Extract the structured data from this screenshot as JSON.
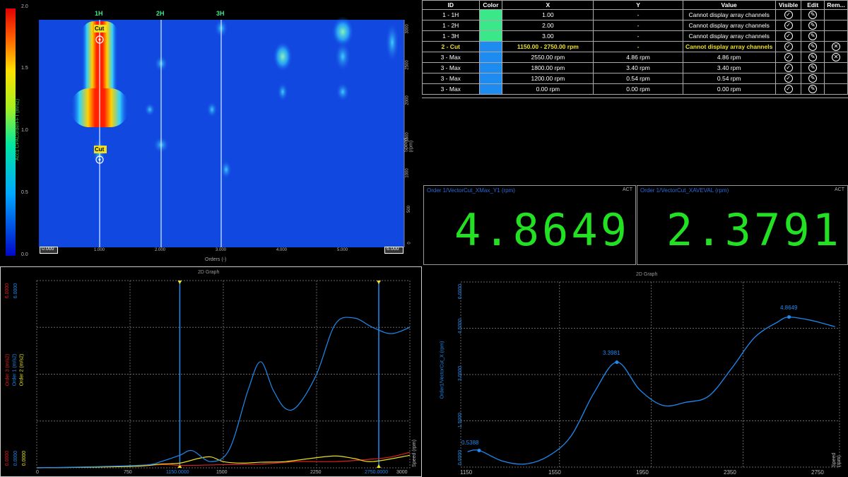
{
  "heatmap": {
    "colorbar_ticks": [
      "2.0",
      "1.5",
      "1.0",
      "0.5",
      "0.0"
    ],
    "colorbar_label": "Acc1 CPACorderFFT (m/s2)",
    "top_labels": [
      "1H",
      "2H",
      "3H"
    ],
    "cursor_labels": [
      "Cut",
      "Cut"
    ],
    "x_ticks": [
      "1.000",
      "2.000",
      "3.000",
      "4.000",
      "5.000"
    ],
    "x_min_label": "0.000",
    "x_max_label": "6.000",
    "x_label": "Orders (-)",
    "y_ticks": [
      "3000",
      "2500",
      "2000",
      "1500",
      "1000",
      "500",
      "0"
    ],
    "y_label": "Speed (rpm)"
  },
  "cursor_table": {
    "headers": [
      "ID",
      "Color",
      "X",
      "Y",
      "Value",
      "Visible",
      "Edit",
      "Rem..."
    ],
    "rows": [
      {
        "id": "1 - 1H",
        "color": "#3ae88a",
        "x": "1.00",
        "y": "-",
        "value": "Cannot display array channels",
        "rm": false,
        "hl": false
      },
      {
        "id": "1 - 2H",
        "color": "#3ae88a",
        "x": "2.00",
        "y": "-",
        "value": "Cannot display array channels",
        "rm": false,
        "hl": false
      },
      {
        "id": "1 - 3H",
        "color": "#3ae88a",
        "x": "3.00",
        "y": "-",
        "value": "Cannot display array channels",
        "rm": false,
        "hl": false
      },
      {
        "id": "2 - Cut",
        "color": "#1e8bf0",
        "x": "1150.00 - 2750.00 rpm",
        "y": "-",
        "value": "Cannot display array channels",
        "rm": true,
        "hl": true
      },
      {
        "id": "3 - Max",
        "color": "#1e8bf0",
        "x": "2550.00 rpm",
        "y": "4.86 rpm",
        "value": "4.86 rpm",
        "rm": true,
        "hl": false
      },
      {
        "id": "3 - Max",
        "color": "#1e8bf0",
        "x": "1800.00 rpm",
        "y": "3.40 rpm",
        "value": "3.40 rpm",
        "rm": false,
        "hl": false
      },
      {
        "id": "3 - Max",
        "color": "#1e8bf0",
        "x": "1200.00 rpm",
        "y": "0.54 rpm",
        "value": "0.54 rpm",
        "rm": false,
        "hl": false
      },
      {
        "id": "3 - Max",
        "color": "#1e8bf0",
        "x": "0.00 rpm",
        "y": "0.00 rpm",
        "value": "0.00 rpm",
        "rm": false,
        "hl": false
      }
    ]
  },
  "digital": [
    {
      "title": "Order 1/VectorCut_XMax_Y1 (rpm)",
      "act": "ACT",
      "value": "4.8649"
    },
    {
      "title": "Order 1/VectorCut_XAVEVAL (rpm)",
      "act": "ACT",
      "value": "2.3791"
    }
  ],
  "graph_left": {
    "title": "2D Graph",
    "y_axis_labels": [
      {
        "text": "Order 3 (m/s2)",
        "color": "#e02020"
      },
      {
        "text": "Order 1 (m/s2)",
        "color": "#1e8bf0"
      },
      {
        "text": "Order 2 (m/s2)",
        "color": "#e8e020"
      }
    ],
    "y_top_red": "6.0000",
    "y_top_blue": "6.0000",
    "y_bot_red": "0.0000",
    "y_bot_blue": "0.0000",
    "y_bot_yellow": "0.0000",
    "x_ticks": [
      "0",
      "750",
      "1150.0000",
      "1500",
      "2250",
      "2750.0000",
      "3000"
    ],
    "x_axis_label": "Speed (rpm)"
  },
  "graph_right": {
    "title": "2D Graph",
    "y_axis_label": "Order1/VectorCut_X (rpm)",
    "y_ticks": [
      "6.0000",
      "4.5000",
      "3.0000",
      "1.5000",
      "0.0000"
    ],
    "x_ticks": [
      "1150",
      "1550",
      "1950",
      "2350",
      "2750"
    ],
    "x_axis_label": "Speed (rpm)",
    "peak_labels": [
      "4.8649",
      "3.3981",
      "0.5388"
    ]
  },
  "chart_data": [
    {
      "type": "heatmap",
      "xlabel": "Orders (-)",
      "ylabel": "Speed (rpm)",
      "xlim": [
        0,
        6
      ],
      "ylim": [
        0,
        3000
      ],
      "colorbar_label": "Acc1 CPACorderFFT (m/s2)",
      "colorbar_range": [
        0,
        2
      ]
    },
    {
      "type": "line",
      "xlabel": "Speed (rpm)",
      "xlim": [
        0,
        3000
      ],
      "ylim": [
        0,
        6
      ],
      "series": [
        {
          "name": "Order 1 (m/s2)",
          "color": "#1e8bf0",
          "x": [
            0,
            300,
            600,
            900,
            1000,
            1150,
            1250,
            1400,
            1550,
            1700,
            1800,
            1900,
            2000,
            2100,
            2250,
            2400,
            2550,
            2700,
            2850,
            3000
          ],
          "values": [
            0,
            0.02,
            0.05,
            0.1,
            0.2,
            0.4,
            0.55,
            0.2,
            0.6,
            2.5,
            3.4,
            2.5,
            1.9,
            2.0,
            3.0,
            4.6,
            4.8,
            4.5,
            4.3,
            4.5
          ]
        },
        {
          "name": "Order 2 (m/s2)",
          "color": "#e8e020",
          "x": [
            0,
            400,
            800,
            1000,
            1150,
            1300,
            1400,
            1500,
            1650,
            1800,
            2000,
            2200,
            2400,
            2550,
            2700,
            3000
          ],
          "values": [
            0,
            0.02,
            0.05,
            0.12,
            0.15,
            0.3,
            0.35,
            0.2,
            0.15,
            0.18,
            0.2,
            0.3,
            0.38,
            0.3,
            0.2,
            0.4
          ]
        },
        {
          "name": "Order 3 (m/s2)",
          "color": "#e02020",
          "x": [
            0,
            400,
            800,
            1000,
            1200,
            1500,
            1800,
            2100,
            2400,
            2700,
            2850,
            3000
          ],
          "values": [
            0,
            0.02,
            0.05,
            0.1,
            0.08,
            0.1,
            0.12,
            0.2,
            0.2,
            0.28,
            0.35,
            0.5
          ]
        }
      ]
    },
    {
      "type": "line",
      "xlabel": "Speed (rpm)",
      "ylabel": "Order1/VectorCut_X (rpm)",
      "xlim": [
        1120,
        2770
      ],
      "ylim": [
        0,
        6
      ],
      "series": [
        {
          "color": "#1e8bf0",
          "x": [
            1150,
            1200,
            1300,
            1400,
            1500,
            1600,
            1700,
            1800,
            1900,
            2000,
            2100,
            2200,
            2300,
            2400,
            2500,
            2550,
            2650,
            2750
          ],
          "values": [
            0.5,
            0.54,
            0.2,
            0.1,
            0.35,
            1.0,
            2.4,
            3.4,
            2.5,
            2.0,
            2.1,
            2.3,
            3.2,
            4.2,
            4.7,
            4.86,
            4.75,
            4.55
          ]
        }
      ],
      "annotations": [
        {
          "x": 2550,
          "y": 4.8649,
          "text": "4.8649"
        },
        {
          "x": 1800,
          "y": 3.3981,
          "text": "3.3981"
        },
        {
          "x": 1200,
          "y": 0.5388,
          "text": "0.5388"
        }
      ]
    }
  ]
}
